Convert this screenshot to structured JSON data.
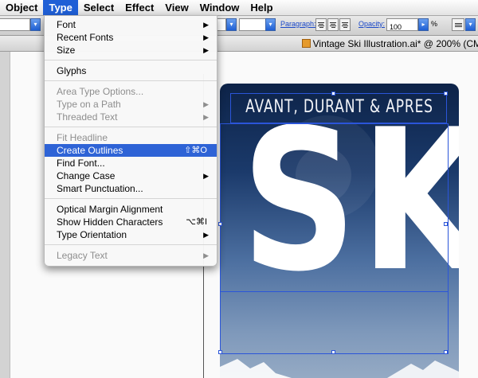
{
  "menubar": {
    "items": [
      "Object",
      "Type",
      "Select",
      "Effect",
      "View",
      "Window",
      "Help"
    ],
    "active": "Type"
  },
  "toolbar": {
    "paragraph_label": "Paragraph:",
    "opacity_label": "Opacity:",
    "opacity_value": "100",
    "percent_sign": "%"
  },
  "document": {
    "title": "Vintage Ski Illustration.ai* @ 200% (CM"
  },
  "type_menu": {
    "font": "Font",
    "recent_fonts": "Recent Fonts",
    "size": "Size",
    "glyphs": "Glyphs",
    "area_type_options": "Area Type Options...",
    "type_on_path": "Type on a Path",
    "threaded_text": "Threaded Text",
    "fit_headline": "Fit Headline",
    "create_outlines": "Create Outlines",
    "create_outlines_shortcut": "⇧⌘O",
    "find_font": "Find Font...",
    "change_case": "Change Case",
    "smart_punctuation": "Smart Punctuation...",
    "optical_margin": "Optical Margin Alignment",
    "show_hidden": "Show Hidden Characters",
    "show_hidden_shortcut": "⌥⌘I",
    "type_orientation": "Type Orientation",
    "legacy_text": "Legacy Text"
  },
  "poster": {
    "subtitle": "AVANT, DURANT & APRES",
    "headline": "SKI"
  },
  "colors": {
    "menu_highlight": "#2e63d6",
    "selection": "#2b55d9",
    "poster_top": "#0d2348",
    "poster_bottom": "#95aac4"
  }
}
